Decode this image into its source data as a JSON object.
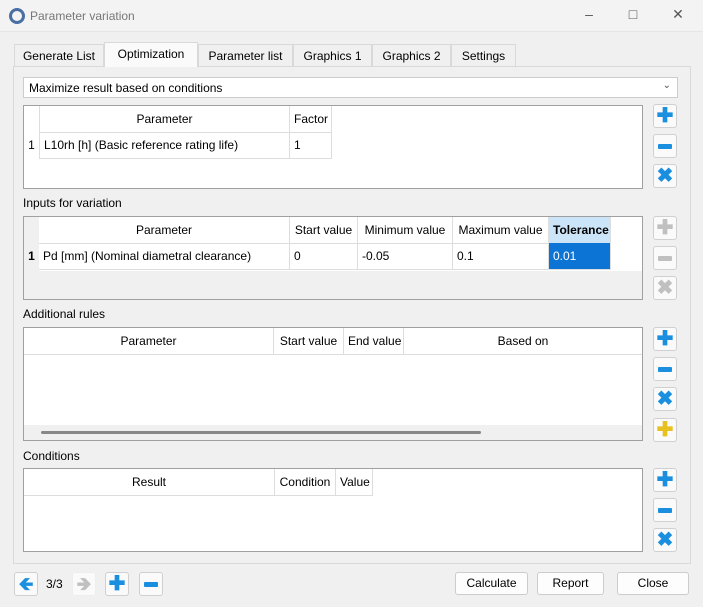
{
  "window": {
    "title": "Parameter variation"
  },
  "tabs": [
    {
      "label": "Generate List"
    },
    {
      "label": "Optimization"
    },
    {
      "label": "Parameter list"
    },
    {
      "label": "Graphics 1"
    },
    {
      "label": "Graphics 2"
    },
    {
      "label": "Settings"
    }
  ],
  "active_tab": "Optimization",
  "mode": {
    "selected": "Maximize result based on conditions"
  },
  "results_table": {
    "headers": [
      "Parameter",
      "Factor"
    ],
    "rows": [
      {
        "n": "1",
        "parameter": "L10rh [h]  (Basic reference rating life)",
        "factor": "1"
      }
    ]
  },
  "inputs": {
    "label": "Inputs for variation",
    "headers": [
      "Parameter",
      "Start value",
      "Minimum value",
      "Maximum value",
      "Tolerance"
    ],
    "rows": [
      {
        "n": "1",
        "parameter": "Pd [mm]  (Nominal diametral clearance)",
        "start": "0",
        "min": "-0.05",
        "max": "0.1",
        "tolerance": "0.01"
      }
    ]
  },
  "rules": {
    "label": "Additional rules",
    "headers": [
      "Parameter",
      "Start value",
      "End value",
      "Based on"
    ]
  },
  "conditions": {
    "label": "Conditions",
    "headers": [
      "Result",
      "Condition",
      "Value"
    ]
  },
  "footer": {
    "page": "3/3",
    "calculate": "Calculate",
    "report": "Report",
    "close": "Close"
  },
  "colors": {
    "accent": "#1a8fe0",
    "selection": "#0b74d4"
  }
}
